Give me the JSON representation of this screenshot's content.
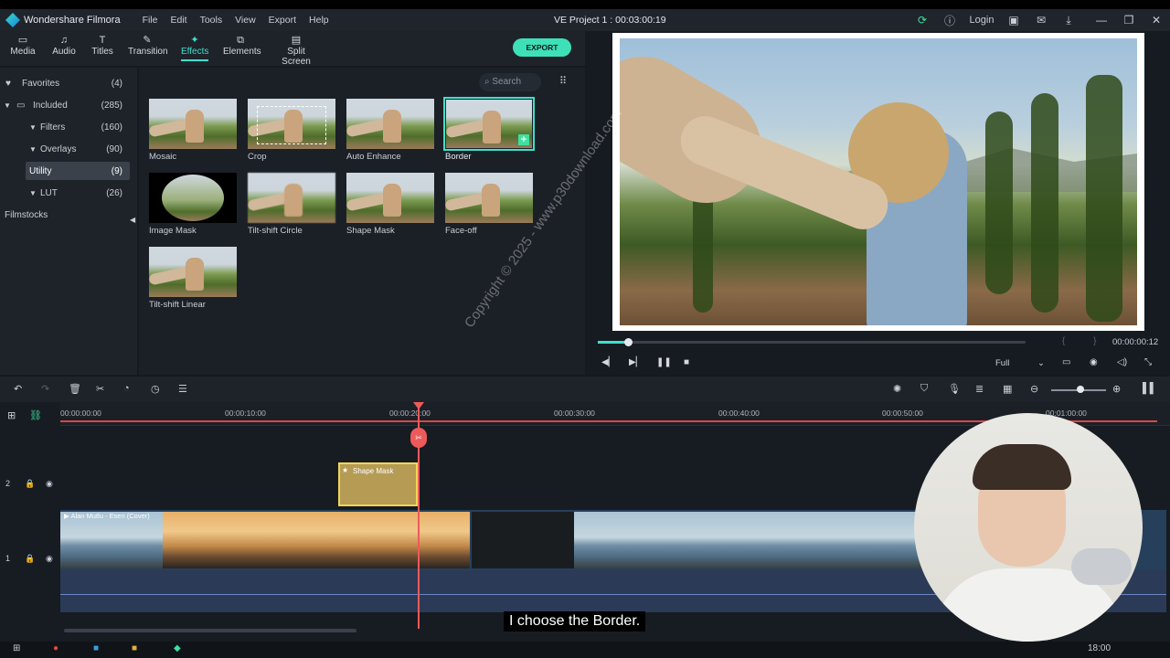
{
  "titlebar": {
    "app_title": "Wondershare Filmora",
    "menu": [
      "File",
      "Edit",
      "Tools",
      "View",
      "Export",
      "Help"
    ],
    "project_title": "VE Project 1 : 00:03:00:19",
    "login": "Login"
  },
  "nav": {
    "tabs": [
      {
        "label": "Media",
        "icon": "folder-icon"
      },
      {
        "label": "Audio",
        "icon": "music-note-icon"
      },
      {
        "label": "Titles",
        "icon": "text-icon"
      },
      {
        "label": "Transition",
        "icon": "transition-icon"
      },
      {
        "label": "Effects",
        "icon": "effects-icon"
      },
      {
        "label": "Elements",
        "icon": "elements-icon"
      },
      {
        "label": "Split Screen",
        "icon": "split-screen-icon"
      }
    ],
    "active_tab": "Effects",
    "export_label": "EXPORT"
  },
  "sidebar": {
    "items": [
      {
        "label": "Favorites",
        "count": "(4)"
      },
      {
        "label": "Included",
        "count": "(285)"
      },
      {
        "label": "Filters",
        "count": "(160)"
      },
      {
        "label": "Overlays",
        "count": "(90)"
      },
      {
        "label": "Utility",
        "count": "(9)"
      },
      {
        "label": "LUT",
        "count": "(26)"
      }
    ],
    "filmstocks": "Filmstocks"
  },
  "media": {
    "search_placeholder": "Search",
    "effects": [
      {
        "label": "Mosaic"
      },
      {
        "label": "Crop"
      },
      {
        "label": "Auto Enhance"
      },
      {
        "label": "Border"
      },
      {
        "label": "Image Mask"
      },
      {
        "label": "Tilt-shift Circle"
      },
      {
        "label": "Shape Mask"
      },
      {
        "label": "Face-off"
      },
      {
        "label": "Tilt-shift Linear"
      }
    ],
    "selected": "Border"
  },
  "preview": {
    "current_time": "00:00:00:12",
    "quality": "Full",
    "progress": 0.07
  },
  "timeline": {
    "ticks": [
      "00:00:00:00",
      "00:00:10:00",
      "00:00:20:00",
      "00:00:30:00",
      "00:00:40:00",
      "00:00:50:00",
      "00:01:00:00"
    ],
    "fx_clip_label": "Shape Mask",
    "video_clip_label": "Alan Mutlu - Esen (Cover)",
    "track_2": "2",
    "track_1": "1"
  },
  "caption": "I choose the Border.",
  "watermark": "Copyright © 2025 - www.p30download.com",
  "taskbar": {
    "time": "18:00"
  },
  "colors": {
    "accent": "#3ee0cc",
    "playhead": "#ee5a5a",
    "export": "#3ee0b8"
  }
}
